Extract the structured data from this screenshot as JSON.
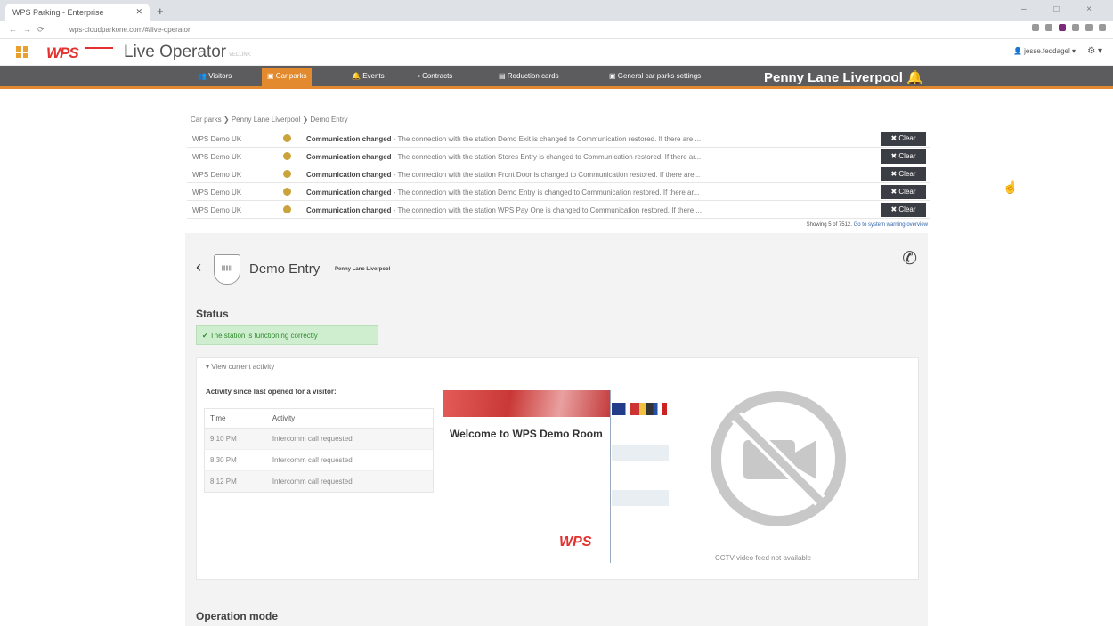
{
  "browser": {
    "tab_title": "WPS Parking - Enterprise",
    "url": "wps-cloudparkone.com/#/live-operator",
    "window_controls": "– □ ×"
  },
  "app": {
    "title": "Live Operator",
    "version": "VELLINK",
    "logo_text": "WPS",
    "user": "jesse.feddagel",
    "brand_color": "#e2312e",
    "accent_color": "#e38a2e"
  },
  "nav": {
    "items": [
      {
        "label": "Visitors",
        "icon": "people-icon"
      },
      {
        "label": "Car parks",
        "icon": "carpark-icon",
        "active": true
      },
      {
        "label": "Events",
        "icon": "bell-icon"
      },
      {
        "label": "Contracts",
        "icon": "contract-icon"
      },
      {
        "label": "Reduction cards",
        "icon": "card-icon"
      },
      {
        "label": "General car parks settings",
        "icon": "settings-icon"
      }
    ],
    "location": "Penny Lane Liverpool"
  },
  "breadcrumbs": [
    "Car parks",
    "Penny Lane Liverpool",
    "Demo Entry"
  ],
  "alerts": {
    "rows": [
      {
        "source": "WPS Demo UK",
        "title": "Communication changed",
        "text": " - The connection with the station Demo Exit is changed to Communication restored. If there are ..."
      },
      {
        "source": "WPS Demo UK",
        "title": "Communication changed",
        "text": " - The connection with the station Stores Entry is changed to Communication restored. If there ar..."
      },
      {
        "source": "WPS Demo UK",
        "title": "Communication changed",
        "text": " - The connection with the station Front Door is changed to Communication restored. If there are..."
      },
      {
        "source": "WPS Demo UK",
        "title": "Communication changed",
        "text": " - The connection with the station Demo Entry is changed to Communication restored. If there ar..."
      },
      {
        "source": "WPS Demo UK",
        "title": "Communication changed",
        "text": " - The connection with the station WPS Pay One is changed to Communication restored. If there ..."
      }
    ],
    "clear_label": "✖ Clear",
    "showing": "Showing 5 of 7512",
    "overview_link": "Go to system warning overview"
  },
  "device": {
    "badge": "||||||||",
    "title": "Demo Entry",
    "subtitle": "Penny Lane Liverpool",
    "status_heading": "Status",
    "status_text": "✔ The station is functioning correctly",
    "view_toggle": "▾ View current activity",
    "activity_heading": "Activity since last opened for a visitor:",
    "table": {
      "headers": [
        "Time",
        "Activity"
      ],
      "rows": [
        [
          "9:10 PM",
          "Intercomm call requested"
        ],
        [
          "8:30 PM",
          "Intercomm call requested"
        ],
        [
          "8:12 PM",
          "Intercomm call requested"
        ]
      ]
    },
    "kiosk_welcome": "Welcome to WPS Demo Room",
    "cctv_caption": "CCTV video feed not available",
    "operation_mode_heading": "Operation mode"
  }
}
